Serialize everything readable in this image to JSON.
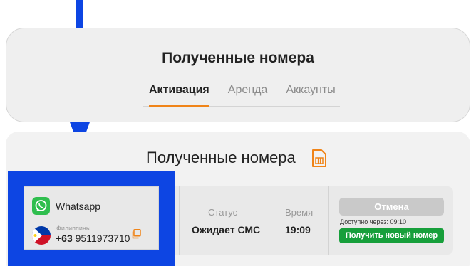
{
  "header": {
    "title": "Полученные номера",
    "tabs": [
      {
        "label": "Активация",
        "active": true
      },
      {
        "label": "Аренда",
        "active": false
      },
      {
        "label": "Аккаунты",
        "active": false
      }
    ],
    "accent_color": "#f08418"
  },
  "section": {
    "title": "Полученные номера",
    "icon": "sim-card-icon"
  },
  "number_row": {
    "service": {
      "name": "Whatsapp",
      "icon": "whatsapp-icon"
    },
    "country": {
      "name": "Филиппины",
      "flag": "philippines-flag-icon"
    },
    "phone": {
      "code": "+63",
      "number": "9511973710"
    },
    "status": {
      "label": "Статус",
      "value": "Ожидает СМС"
    },
    "time": {
      "label": "Время",
      "value": "19:09"
    },
    "actions": {
      "cancel_label": "Отмена",
      "available_prefix": "Доступно через:",
      "available_time": "09:10",
      "new_number_label": "Получить новый номер",
      "new_number_color": "#179f3b"
    }
  },
  "annotation": {
    "arrow_color": "#0d45e3",
    "highlight_color": "#0d45e3"
  }
}
